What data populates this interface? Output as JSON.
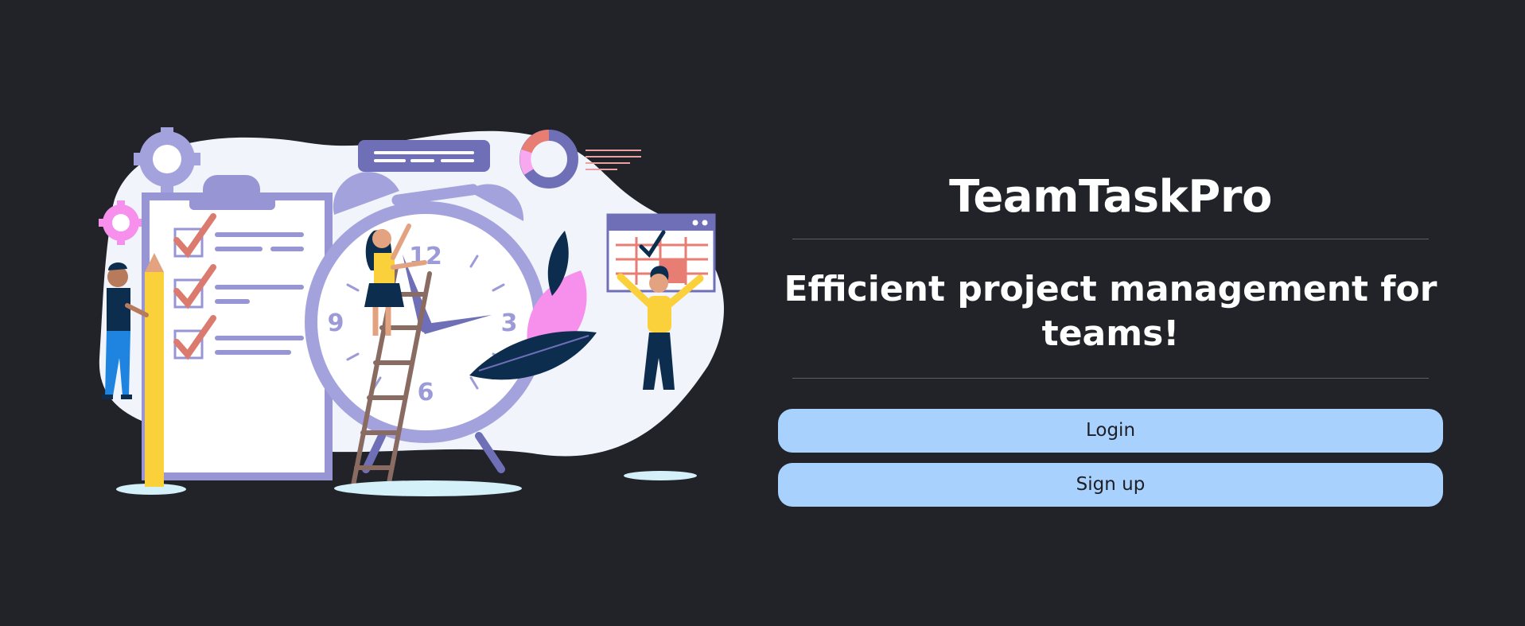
{
  "brand": {
    "title": "TeamTaskPro",
    "tagline": "Efficient project management for teams!"
  },
  "actions": {
    "login_label": "Login",
    "signup_label": "Sign up"
  },
  "illustration": {
    "icon": "team-time-management-illustration",
    "clock_numbers": [
      "12",
      "3",
      "6",
      "9"
    ]
  },
  "colors": {
    "background": "#212328",
    "button": "#a8d1fd",
    "button_text": "#1d1f24",
    "title_text": "#ffffff",
    "accent_purple": "#9c9bd8",
    "accent_yellow": "#fbd13b",
    "accent_pink": "#f6a9ef",
    "accent_navy": "#0c2d4d"
  }
}
